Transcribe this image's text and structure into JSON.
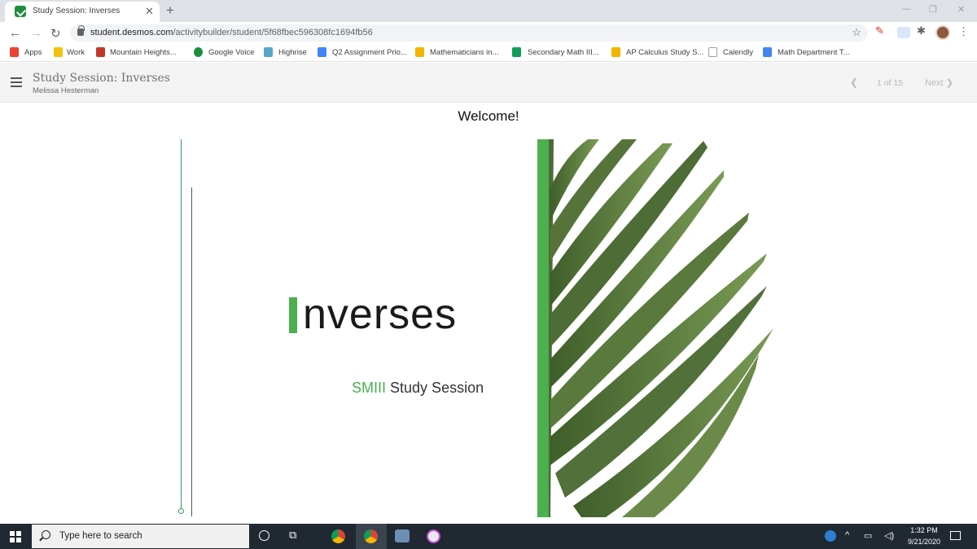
{
  "browser": {
    "tab_title": "Study Session: Inverses",
    "url_domain": "student.desmos.com",
    "url_path": "/activitybuilder/student/5f68fbec596308fc1694fb56",
    "bookmarks": [
      {
        "label": "Apps",
        "icon": "apps-grid-icon",
        "color": "#ea4335"
      },
      {
        "label": "Work",
        "icon": "folder-icon",
        "color": "#f4c20d"
      },
      {
        "label": "Mountain Heights...",
        "icon": "school-icon",
        "color": "#c0392b"
      },
      {
        "label": "Google Voice",
        "icon": "google-voice-icon",
        "color": "#1e8e3e"
      },
      {
        "label": "Highrise",
        "icon": "highrise-icon",
        "color": "#5aa6c8"
      },
      {
        "label": "Q2 Assignment Prio...",
        "icon": "google-docs-icon",
        "color": "#4285f4"
      },
      {
        "label": "Mathematicians in...",
        "icon": "google-slides-icon",
        "color": "#f4b400"
      },
      {
        "label": "Secondary Math III...",
        "icon": "google-sheets-icon",
        "color": "#0f9d58"
      },
      {
        "label": "AP Calculus Study S...",
        "icon": "google-slides-icon",
        "color": "#f4b400"
      },
      {
        "label": "Calendly",
        "icon": "calendar-icon",
        "color": "#9e9e9e"
      },
      {
        "label": "Math Department T...",
        "icon": "google-docs-icon",
        "color": "#4285f4"
      }
    ]
  },
  "header": {
    "title": "Study Session: Inverses",
    "author": "Melissa Hesterman",
    "page_count": "1 of 15",
    "next_label": "Next"
  },
  "slide": {
    "welcome": "Welcome!",
    "title_rest": "nverses",
    "subtitle_accent": "SMIII",
    "subtitle_rest": "Study Session",
    "accent_color": "#4caf50"
  },
  "taskbar": {
    "search_placeholder": "Type here to search",
    "time": "1:32 PM",
    "date": "9/21/2020"
  }
}
